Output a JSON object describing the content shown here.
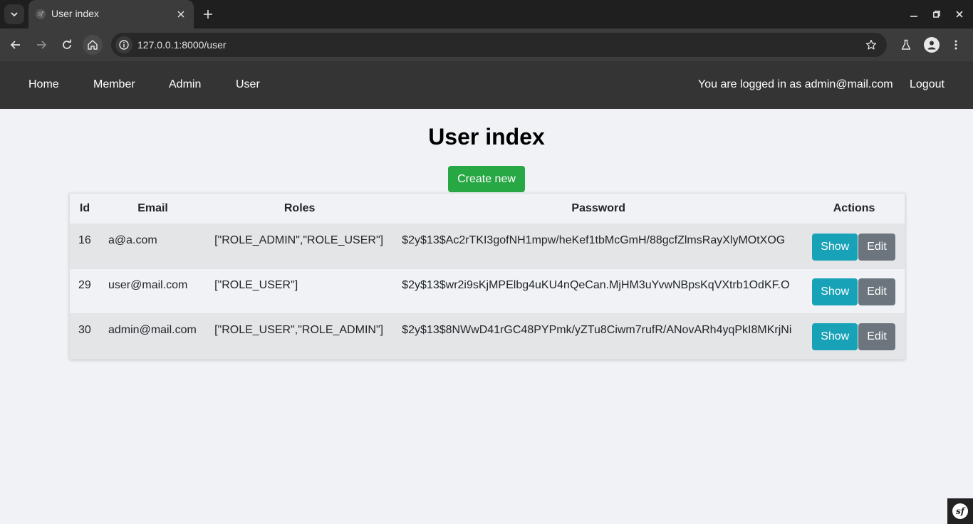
{
  "browser": {
    "tab_title": "User index",
    "favicon_text": "sf",
    "url": "127.0.0.1:8000/user"
  },
  "navbar": {
    "links": [
      "Home",
      "Member",
      "Admin",
      "User"
    ],
    "logged_in_text": "You are logged in as admin@mail.com",
    "logout_label": "Logout"
  },
  "page": {
    "title": "User index",
    "create_label": "Create new"
  },
  "table": {
    "headers": [
      "Id",
      "Email",
      "Roles",
      "Password",
      "Actions"
    ],
    "rows": [
      {
        "id": "16",
        "email": "a@a.com",
        "roles": "[\"ROLE_ADMIN\",\"ROLE_USER\"]",
        "password": "$2y$13$Ac2rTKI3gofNH1mpw/heKef1tbMcGmH/88gcfZlmsRayXlyMOtXOG",
        "show": "Show",
        "edit": "Edit"
      },
      {
        "id": "29",
        "email": "user@mail.com",
        "roles": "[\"ROLE_USER\"]",
        "password": "$2y$13$wr2i9sKjMPElbg4uKU4nQeCan.MjHM3uYvwNBpsKqVXtrb1OdKF.O",
        "show": "Show",
        "edit": "Edit"
      },
      {
        "id": "30",
        "email": "admin@mail.com",
        "roles": "[\"ROLE_USER\",\"ROLE_ADMIN\"]",
        "password": "$2y$13$8NWwD41rGC48PYPmk/yZTu8Ciwm7rufR/ANovARh4yqPkI8MKrjNi",
        "show": "Show",
        "edit": "Edit"
      }
    ]
  },
  "toolbar_badge": {
    "text": "sf"
  },
  "colors": {
    "navbar_bg": "#343434",
    "create_button": "#28a745",
    "show_button": "#17a2b8",
    "edit_button": "#6c757d",
    "page_bg": "#f0f2f5"
  }
}
